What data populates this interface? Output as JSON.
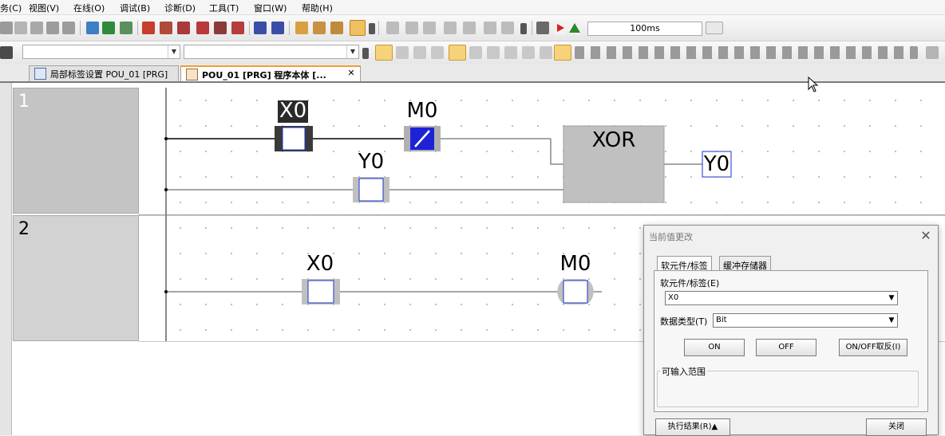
{
  "menu": {
    "items": [
      "务(C)",
      "视图(V)",
      "在线(O)",
      "调试(B)",
      "诊断(D)",
      "工具(T)",
      "窗口(W)",
      "帮助(H)"
    ]
  },
  "toolbar": {
    "monitor_interval": "100ms"
  },
  "tabs": [
    {
      "label": "局部标签设置 POU_01 [PRG]",
      "active": false
    },
    {
      "label": "POU_01 [PRG] 程序本体 [...",
      "active": true
    }
  ],
  "ladder": {
    "rungs": [
      {
        "number": "1",
        "contacts": [
          {
            "label": "X0",
            "type": "normally-open",
            "state": "monitored-off",
            "selected": true
          },
          {
            "label": "M0",
            "type": "normally-closed",
            "state": "energized"
          },
          {
            "label": "Y0",
            "type": "normally-open",
            "state": "off"
          }
        ],
        "function_block": {
          "label": "XOR"
        },
        "output": {
          "label": "Y0"
        }
      },
      {
        "number": "2",
        "contacts": [
          {
            "label": "X0",
            "type": "normally-open",
            "state": "off"
          }
        ],
        "coil": {
          "label": "M0"
        }
      }
    ]
  },
  "dialog": {
    "title": "当前值更改",
    "tabs": [
      "软元件/标签",
      "缓冲存储器"
    ],
    "device_label": "软元件/标签(E)",
    "device_value": "X0",
    "datatype_label": "数据类型(T)",
    "datatype_value": "Bit",
    "btn_on": "ON",
    "btn_off": "OFF",
    "btn_toggle": "ON/OFF取反(I)",
    "range_label": "可输入范围",
    "result_button": "执行结果(R)▲",
    "close_button": "关闭"
  },
  "colors": {
    "accent_blue": "#1432d2",
    "energized_fill": "#1e22d6",
    "rung_header": "#c4c4c4",
    "function_block": "#c0c0c0"
  }
}
